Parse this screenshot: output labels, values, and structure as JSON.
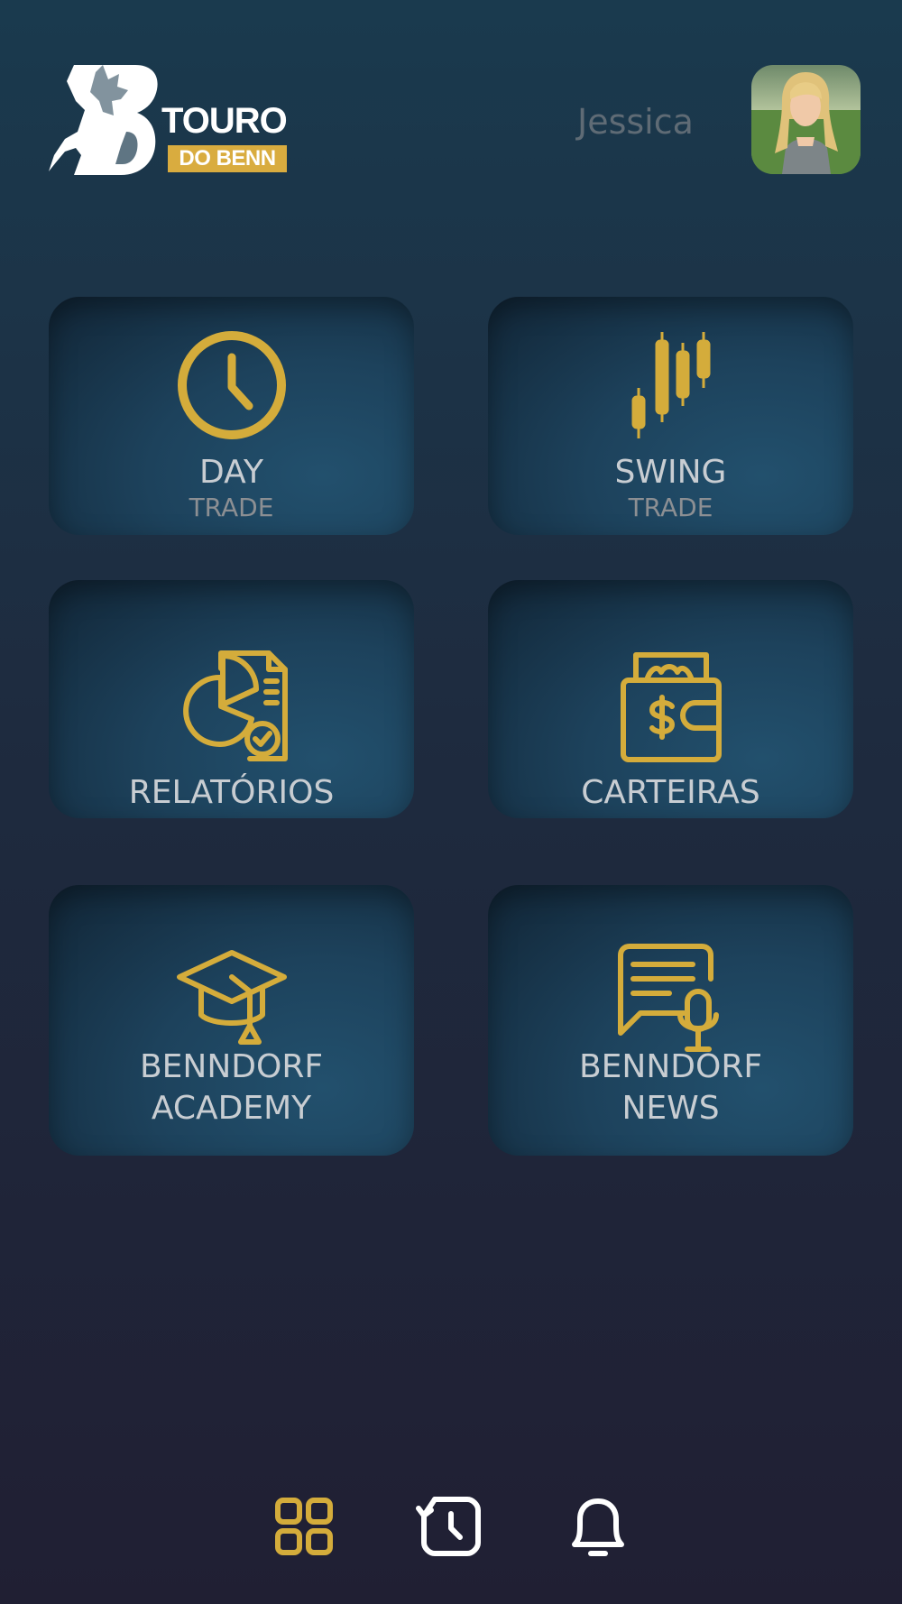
{
  "header": {
    "logo": {
      "line1": "TOURO",
      "line2": "DO BENN"
    },
    "username": "Jessica"
  },
  "colors": {
    "accent": "#d4ac3b",
    "label": "#c8cdd2",
    "sublabel": "#8c8f93",
    "username": "#5f6b75"
  },
  "cards": [
    {
      "title": "DAY",
      "subtitle": "TRADE",
      "icon": "clock-icon"
    },
    {
      "title": "SWING",
      "subtitle": "TRADE",
      "icon": "candlestick-chart-icon"
    },
    {
      "title": "RELATÓRIOS",
      "icon": "report-pie-chart-icon"
    },
    {
      "title": "CARTEIRAS",
      "icon": "wallet-icon"
    },
    {
      "title_line1": "BENNDORF",
      "title_line2": "ACADEMY",
      "icon": "graduation-cap-icon"
    },
    {
      "title_line1": "BENNDORF",
      "title_line2": "NEWS",
      "icon": "news-podcast-icon"
    }
  ],
  "nav": [
    {
      "icon": "dashboard-grid-icon",
      "active": true
    },
    {
      "icon": "history-icon",
      "active": false
    },
    {
      "icon": "bell-icon",
      "active": false
    }
  ]
}
